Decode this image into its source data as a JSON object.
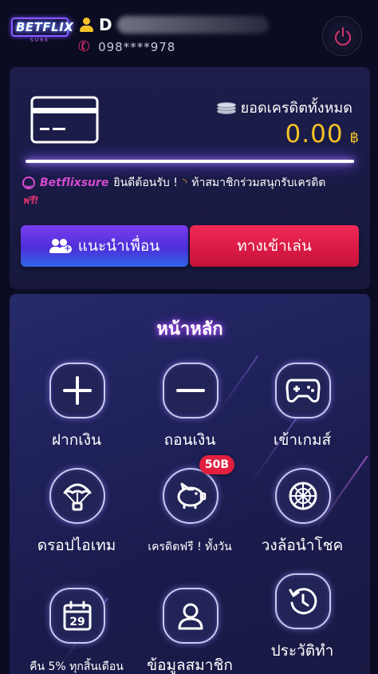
{
  "header": {
    "logo_text": "BETFLIX",
    "logo_sub": "SURE",
    "user_name": "D",
    "phone": "098****978"
  },
  "credit": {
    "label": "ยอดเครดิตทั้งหมด",
    "amount": "0.00",
    "currency": "฿"
  },
  "announcement": {
    "brand": "Betflixsure",
    "welcome": "ยินดีต้อนรับ !",
    "promo": "ท้าสมาชิกร่วมสนุกรับเครดิต",
    "promo_free": "ฟรี!"
  },
  "actions": {
    "refer_label": "แนะนำเพื่อน",
    "play_label": "ทางเข้าเล่น"
  },
  "menu": {
    "title": "หน้าหลัก",
    "items": [
      {
        "label": "ฝากเงิน",
        "icon": "plus-icon"
      },
      {
        "label": "ถอนเงิน",
        "icon": "minus-icon"
      },
      {
        "label": "เข้าเกมส์",
        "icon": "gamepad-icon"
      },
      {
        "label": "ดรอปไอเทม",
        "icon": "parachute-icon"
      },
      {
        "label": "เครดิตฟรี ! ทั้งวัน",
        "icon": "piggy-bank-icon",
        "badge": "50B"
      },
      {
        "label": "วงล้อนำโชค",
        "icon": "wheel-icon"
      },
      {
        "label": "คืน 5% ทุกสิ้นเดือน",
        "icon": "calendar-icon",
        "calendar_day": "29"
      },
      {
        "label": "ข้อมูลสมาชิก",
        "icon": "user-icon"
      },
      {
        "label": "ประวัติทำ",
        "icon": "history-icon"
      }
    ]
  },
  "colors": {
    "accent_gold": "#f3c227",
    "accent_pink": "#d34bd0",
    "play_red": "#d81a44",
    "refer_purple": "#4d2fd9",
    "badge_red": "#e21f3f"
  }
}
